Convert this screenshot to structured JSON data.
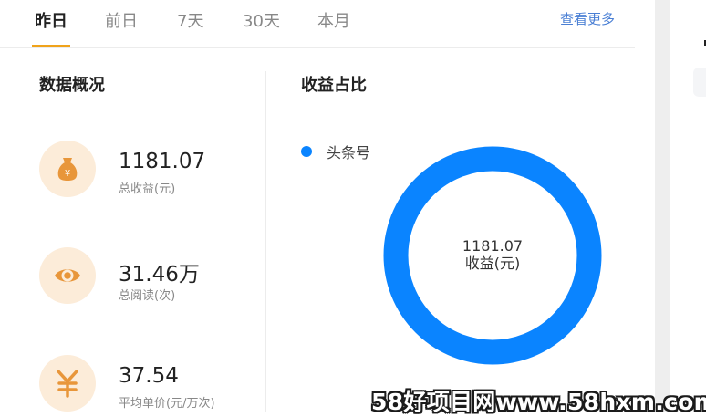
{
  "tabs": [
    {
      "label": "昨日",
      "active": true
    },
    {
      "label": "前日",
      "active": false
    },
    {
      "label": "7天",
      "active": false
    },
    {
      "label": "30天",
      "active": false
    },
    {
      "label": "本月",
      "active": false
    }
  ],
  "more_link": "查看更多",
  "overview": {
    "title": "数据概况",
    "stats": [
      {
        "value": "1181.07",
        "label": "总收益(元)",
        "icon": "money-bag-icon"
      },
      {
        "value": "31.46万",
        "label": "总阅读(次)",
        "icon": "eye-icon"
      },
      {
        "value": "37.54",
        "label": "平均单价(元/万次)",
        "icon": "yuan-icon"
      }
    ]
  },
  "share": {
    "title": "收益占比",
    "center_value": "1181.07",
    "center_label": "收益(元)"
  },
  "chart_data": {
    "type": "pie",
    "categories": [
      "头条号"
    ],
    "values": [
      1181.07
    ],
    "colors": [
      "#0a84ff"
    ],
    "donut": true
  },
  "colors": {
    "accent": "#f0a31a",
    "icon_bg": "#fcecd9",
    "icon": "#e8963a",
    "link": "#4a7fd4",
    "series": "#0a84ff"
  },
  "watermark": "58好项目网www.58hxm.com"
}
